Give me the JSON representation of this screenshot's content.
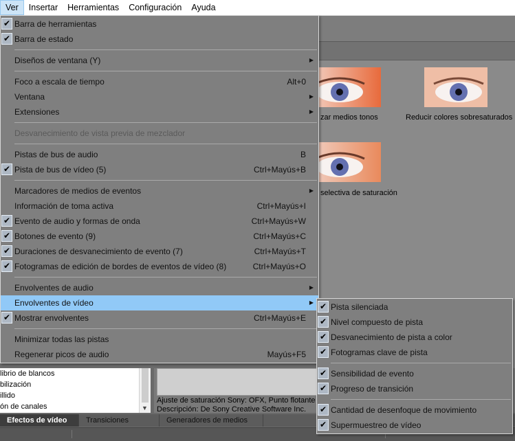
{
  "menubar": {
    "items": [
      "Ver",
      "Insertar",
      "Herramientas",
      "Configuración",
      "Ayuda"
    ]
  },
  "view_menu": {
    "items": [
      {
        "label": "Barra de herramientas",
        "checked": true
      },
      {
        "label": "Barra de estado",
        "checked": true
      },
      {
        "sep": true
      },
      {
        "label": "Diseños de ventana (Y)",
        "submenu": true
      },
      {
        "sep": true
      },
      {
        "label": "Foco a escala de tiempo",
        "shortcut": "Alt+0"
      },
      {
        "label": "Ventana",
        "submenu": true
      },
      {
        "label": "Extensiones",
        "submenu": true
      },
      {
        "sep": true
      },
      {
        "label": "Desvanecimiento de vista previa de mezclador",
        "disabled": true
      },
      {
        "sep": true
      },
      {
        "label": "Pistas de bus de audio",
        "shortcut": "B"
      },
      {
        "label": "Pista de bus de vídeo (5)",
        "shortcut": "Ctrl+Mayús+B",
        "checked": true
      },
      {
        "sep": true
      },
      {
        "label": "Marcadores de medios de eventos",
        "submenu": true
      },
      {
        "label": "Información de toma activa",
        "shortcut": "Ctrl+Mayús+I"
      },
      {
        "label": "Evento de audio y formas de onda",
        "shortcut": "Ctrl+Mayús+W",
        "checked": true
      },
      {
        "label": "Botones de evento (9)",
        "shortcut": "Ctrl+Mayús+C",
        "checked": true
      },
      {
        "label": "Duraciones de desvanecimiento de evento (7)",
        "shortcut": "Ctrl+Mayús+T",
        "checked": true
      },
      {
        "label": "Fotogramas de edición de bordes de eventos de vídeo (8)",
        "shortcut": "Ctrl+Mayús+O",
        "checked": true
      },
      {
        "sep": true
      },
      {
        "label": "Envolventes de audio",
        "submenu": true
      },
      {
        "label": "Envolventes de vídeo",
        "submenu": true,
        "highlight": true
      },
      {
        "label": "Mostrar envolventes",
        "shortcut": "Ctrl+Mayús+E",
        "checked": true
      },
      {
        "sep": true
      },
      {
        "label": "Minimizar todas las pistas"
      },
      {
        "label": "Regenerar picos de audio",
        "shortcut": "Mayús+F5"
      }
    ]
  },
  "envelopes_submenu": {
    "items": [
      {
        "label": "Pista silenciada",
        "checked": true
      },
      {
        "label": "Nivel compuesto de pista",
        "checked": true
      },
      {
        "label": "Desvanecimiento de pista a color",
        "checked": true
      },
      {
        "label": "Fotogramas clave de pista",
        "checked": true
      },
      {
        "sep": true
      },
      {
        "label": "Sensibilidad de evento",
        "checked": true
      },
      {
        "label": "Progreso de transición",
        "checked": true
      },
      {
        "sep": true
      },
      {
        "label": "Cantidad de desenfoque de movimiento",
        "checked": true
      },
      {
        "label": "Supermuestreo de vídeo",
        "checked": true
      }
    ]
  },
  "presets": {
    "label_1": "zar medios tonos",
    "label_2": "Reducir colores sobresaturados",
    "label_3": "selectiva de saturación"
  },
  "fx_list": {
    "rows": [
      "librio de blancos",
      "bilización",
      "illido",
      "ón de canales"
    ]
  },
  "description": {
    "line1": "Ajuste de saturación Sony: OFX, Punto flotante",
    "line2": "Descripción: De Sony Creative Software Inc."
  },
  "tabs": [
    "Efectos de vídeo",
    "Transiciones",
    "Generadores de medios"
  ],
  "icons": {
    "check": "checkmark-icon",
    "submenu": "triangle-right-icon",
    "scroll_down": "chevron-down-icon"
  },
  "colors": {
    "menu_bg": "#7f7f7f",
    "highlight": "#91c9f7",
    "check_bg": "#aeb8c4"
  }
}
